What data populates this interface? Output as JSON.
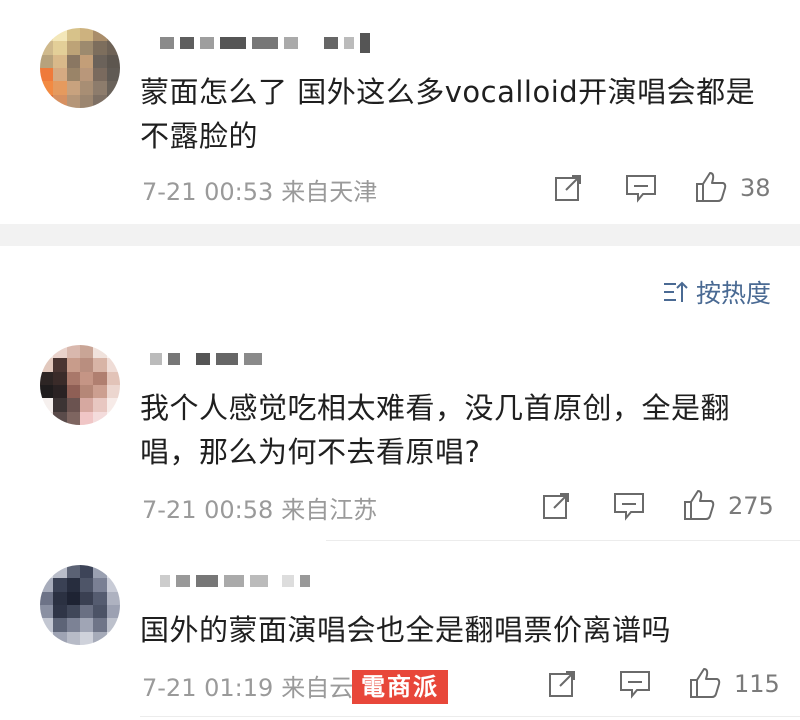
{
  "sort": {
    "label": "按热度"
  },
  "comments": [
    {
      "text": "蒙面怎么了 国外这么多vocalloid开演唱会都是不露脸的",
      "time": "7-21 00:53",
      "location": "来自天津",
      "likes": "38"
    },
    {
      "text": "我个人感觉吃相太难看，没几首原创，全是翻唱，那么为何不去看原唱?",
      "time": "7-21 00:58",
      "location": "来自江苏",
      "likes": "275"
    },
    {
      "text": "国外的蒙面演唱会也全是翻唱票价离谱吗",
      "time": "7-21 01:19",
      "location": "来自云南",
      "likes": "115"
    }
  ],
  "watermark": "電商派",
  "icons": {
    "share": "share-icon",
    "comment": "comment-icon",
    "like": "thumbs-up-icon",
    "sort": "sort-icon"
  }
}
